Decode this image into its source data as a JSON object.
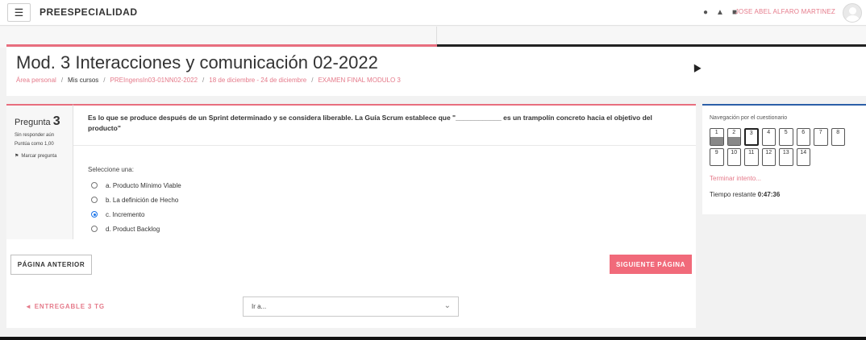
{
  "topbar": {
    "menu_icon": "hamburger-icon",
    "site_title": "PREESPECIALIDAD",
    "icons": [
      "globe-icon",
      "bell-icon",
      "chat-icon"
    ],
    "user_name": "JOSE ABEL ALFARO MARTINEZ"
  },
  "header": {
    "title": "Mod. 3 Interacciones y comunicación 02-2022",
    "breadcrumb": [
      "Área personal",
      "Mis cursos",
      "PREIngensIn03-01NN02-2022",
      "18 de diciembre - 24 de diciembre",
      "EXAMEN FINAL MODULO 3"
    ],
    "separator": "/"
  },
  "question": {
    "label": "Pregunta",
    "number": "3",
    "status": "Sin responder aún",
    "points": "Puntúa como 1,00",
    "flag_label": "Marcar pregunta",
    "text": "Es lo que se produce después de un Sprint determinado y se considera liberable. La Guía Scrum establece que \"____________ es un trampolín concreto hacia el objetivo del producto\"",
    "select_prompt": "Seleccione una:",
    "options": [
      "a. Producto Mínimo Viable",
      "b. La definición de Hecho",
      "c. Incremento",
      "d. Product Backlog"
    ],
    "selected_index": 2
  },
  "buttons": {
    "prev_page": "PÁGINA ANTERIOR",
    "next_page": "SIGUIENTE PÁGINA"
  },
  "footer": {
    "prev_activity": "◄ ENTREGABLE 3 TG",
    "jump_to": "Ir a..."
  },
  "quiz_nav": {
    "title": "Navegación por el cuestionario",
    "questions": [
      "1",
      "2",
      "3",
      "4",
      "5",
      "6",
      "7",
      "8",
      "9",
      "10",
      "11",
      "12",
      "13",
      "14"
    ],
    "answered": [
      1,
      2
    ],
    "current": 3,
    "finish_link": "Terminar intento...",
    "timer_label": "Tiempo restante",
    "timer_value": "0:47:36"
  },
  "colors": {
    "accent": "#f16a7a",
    "link": "#e57a8a",
    "nav_accent": "#2c5fa8"
  }
}
